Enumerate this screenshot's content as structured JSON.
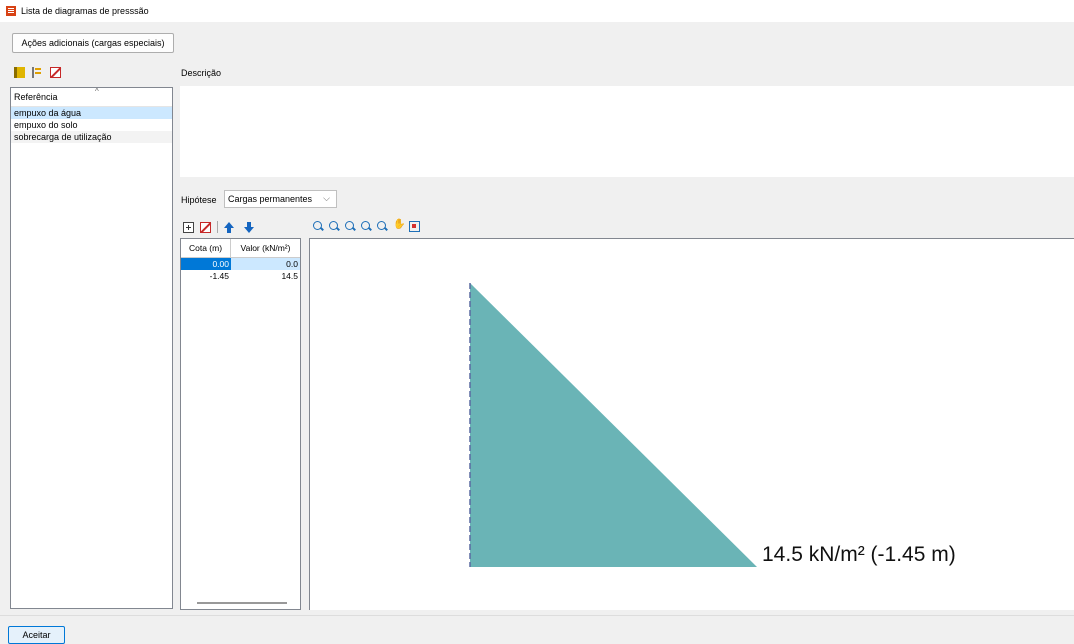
{
  "window": {
    "title": "Lista de diagramas de presssão"
  },
  "toolbar": {
    "extra_actions_label": "Ações adicionais (cargas especiais)"
  },
  "reference_list": {
    "header": "Referência",
    "items": [
      "empuxo da água",
      "empuxo do solo",
      "sobrecarga de utilização"
    ],
    "selected_index": 0
  },
  "description": {
    "label": "Descrição",
    "value": ""
  },
  "hypothesis": {
    "label": "Hipótese",
    "selected": "Cargas permanentes"
  },
  "table": {
    "headers": [
      "Cota (m)",
      "Valor (kN/m²)"
    ],
    "rows": [
      {
        "cota": "0.00",
        "valor": "0.0"
      },
      {
        "cota": "-1.45",
        "valor": "14.5"
      }
    ]
  },
  "diagram": {
    "points": [
      {
        "cota": 0.0,
        "valor": 0.0
      },
      {
        "cota": -1.45,
        "valor": 14.5
      }
    ],
    "annotation": "14.5 kN/m² (-1.45 m)",
    "fill_color": "#6ab4b6",
    "axis_color": "#5a6aa0"
  },
  "icons": {
    "left_toolbar": [
      "book-open-icon",
      "book-list-icon",
      "delete-icon"
    ],
    "table_toolbar": [
      "add-row-icon",
      "delete-row-icon",
      "move-up-icon",
      "move-down-icon"
    ],
    "view_toolbar": [
      "zoom-previous-icon",
      "zoom-all-icon",
      "zoom-window-icon",
      "zoom-realtime-icon",
      "zoom-out-icon",
      "pan-icon",
      "fit-view-icon"
    ]
  },
  "footer": {
    "accept_label": "Aceitar"
  }
}
